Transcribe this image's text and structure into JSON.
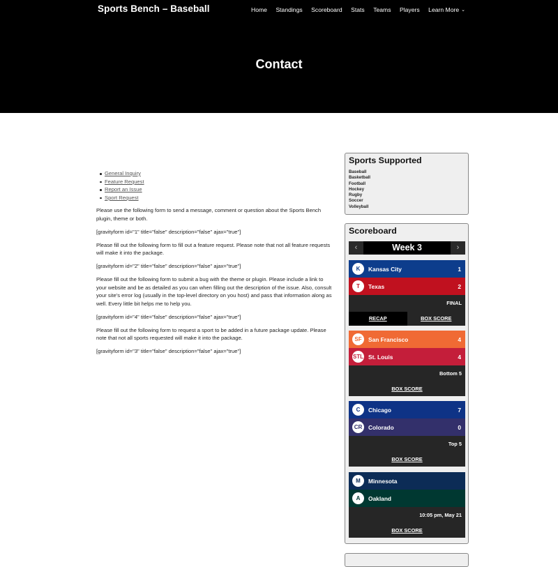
{
  "site": {
    "title": "Sports Bench – Baseball",
    "nav": [
      "Home",
      "Standings",
      "Scoreboard",
      "Stats",
      "Teams",
      "Players",
      "Learn More"
    ],
    "page_title": "Contact"
  },
  "content": {
    "links": [
      "General Inquiry",
      "Feature Request",
      "Report an Issue",
      "Sport Request"
    ],
    "paragraphs": [
      "Please use the following form to send a message, comment or question about the Sports Bench plugin, theme or both.",
      "[gravityform id=\"1\" title=\"false\" description=\"false\" ajax=\"true\"]",
      "Please fill out the following form to fill out a feature request. Please note that not all feature requests will make it into the package.",
      "[gravityform id=\"2\" title=\"false\" description=\"false\" ajax=\"true\"]",
      "Please fill out the following form to submit a bug with the theme or plugin. Please include a link to your website and be as detailed as you can when filling out the description of the issue. Also, consult your site’s error log (usually in the top-level directory on you host) and pass that information along as well. Every little bit helps me to help you.",
      "[gravityform id=\"4\" title=\"false\" description=\"false\" ajax=\"true\"]",
      "Please fill out the following form to request a sport to be added in a future package update. Please note that not all sports requested will make it into the package.",
      "[gravityform id=\"3\" title=\"false\" description=\"false\" ajax=\"true\"]"
    ]
  },
  "sidebar": {
    "sports_title": "Sports Supported",
    "sports": [
      "Baseball",
      "Basketball",
      "Football",
      "Hockey",
      "Rugby",
      "Soccer",
      "Volleyball"
    ],
    "scoreboard_title": "Scoreboard",
    "week_label": "Week 3",
    "prev_icon": "‹",
    "next_icon": "›",
    "recap_label": "RECAP",
    "box_score_label": "BOX SCORE",
    "games": [
      {
        "away": {
          "name": "Kansas City",
          "score": "1",
          "color": "#0d3d8c",
          "logo": "K"
        },
        "home": {
          "name": "Texas",
          "score": "2",
          "color": "#c0111f",
          "logo": "T"
        },
        "status": "FINAL",
        "has_recap": true
      },
      {
        "away": {
          "name": "San Francisco",
          "score": "4",
          "color": "#f06a34",
          "logo": "SF"
        },
        "home": {
          "name": "St. Louis",
          "score": "4",
          "color": "#c41e3a",
          "logo": "STL"
        },
        "status": "Bottom 5",
        "has_recap": false
      },
      {
        "away": {
          "name": "Chicago",
          "score": "7",
          "color": "#0e3386",
          "logo": "C"
        },
        "home": {
          "name": "Colorado",
          "score": "0",
          "color": "#33306b",
          "logo": "CR"
        },
        "status": "Top 5",
        "has_recap": false
      },
      {
        "away": {
          "name": "Minnesota",
          "score": "",
          "color": "#0c2c56",
          "logo": "M"
        },
        "home": {
          "name": "Oakland",
          "score": "",
          "color": "#003831",
          "logo": "A"
        },
        "status": "10:05 pm, May 21",
        "has_recap": false
      }
    ]
  }
}
